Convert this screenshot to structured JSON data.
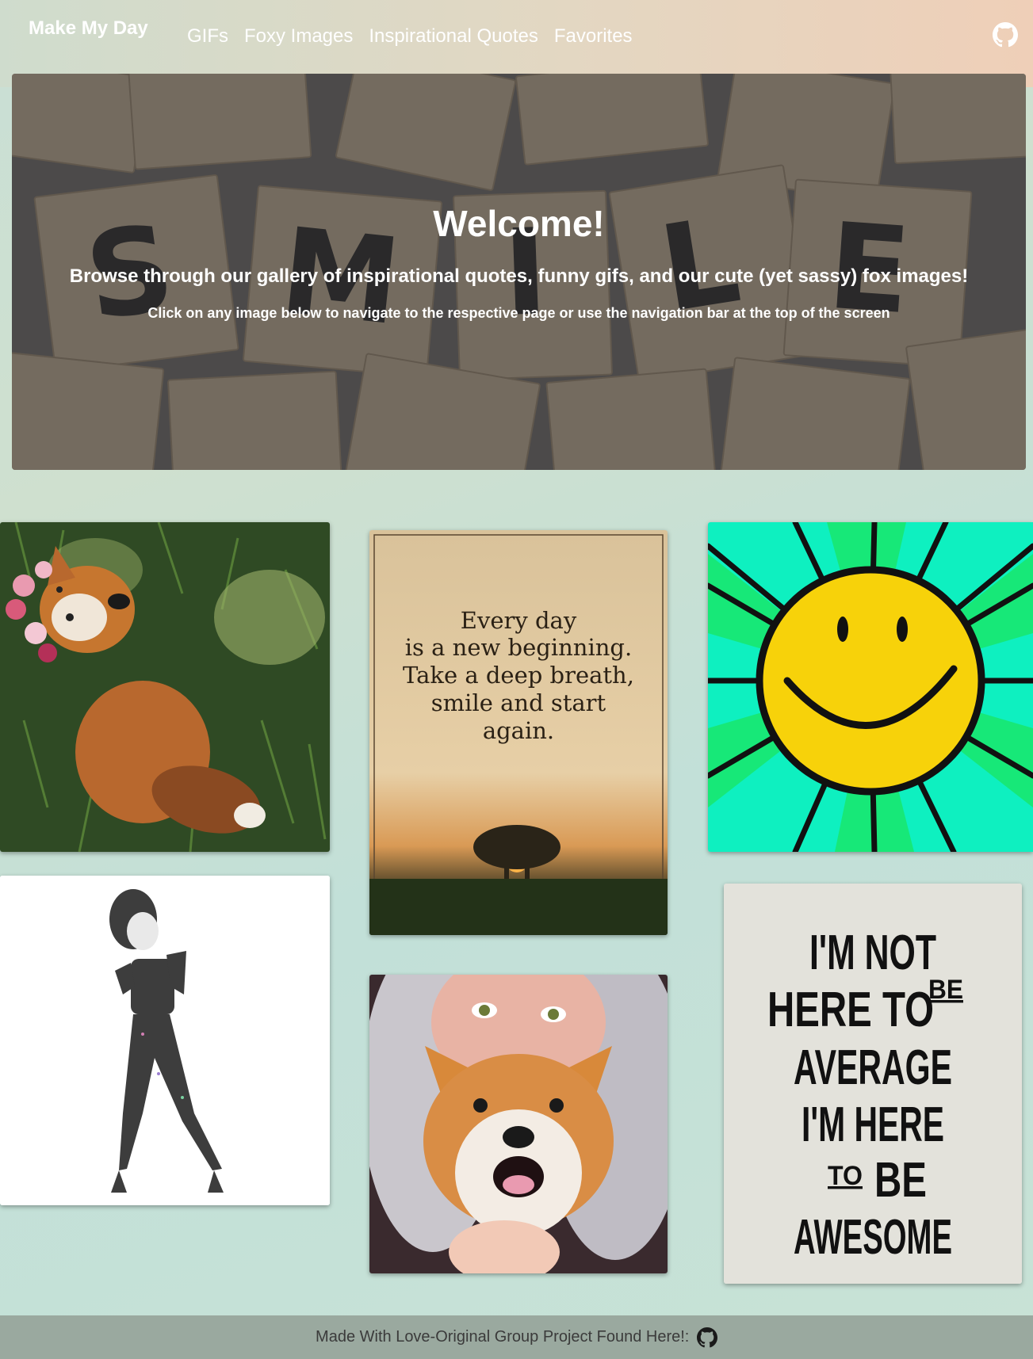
{
  "navbar": {
    "brand": "Make My Day",
    "links": [
      "GIFs",
      "Foxy Images",
      "Inspirational Quotes",
      "Favorites"
    ],
    "github_icon": "github-icon"
  },
  "hero": {
    "title": "Welcome!",
    "subtitle": "Browse through our gallery of inspirational quotes, funny gifs, and our cute (yet sassy) fox images!",
    "instruction": "Click on any image below to navigate to the respective page or use the navigation bar at the top of the screen",
    "background_tiles": [
      "S",
      "M",
      "I",
      "L",
      "E"
    ]
  },
  "gallery": {
    "quote_card_text": [
      "Every day",
      "is a new beginning.",
      "Take a deep breath,",
      "smile and start",
      "again."
    ],
    "poster_card_text": [
      "I'M NOT",
      "HERE TO",
      "BE",
      "AVERAGE",
      "I'M HERE",
      "TO",
      "BE",
      "AWESOME"
    ]
  },
  "footer": {
    "text": "Made With Love-Original Group Project Found Here!:",
    "github_icon": "github-icon"
  },
  "colors": {
    "footer_bg": "#9aa99f",
    "smiley_yellow": "#f7d20a",
    "sunburst_green": "#16e87a",
    "sunburst_teal": "#08f5c8"
  }
}
